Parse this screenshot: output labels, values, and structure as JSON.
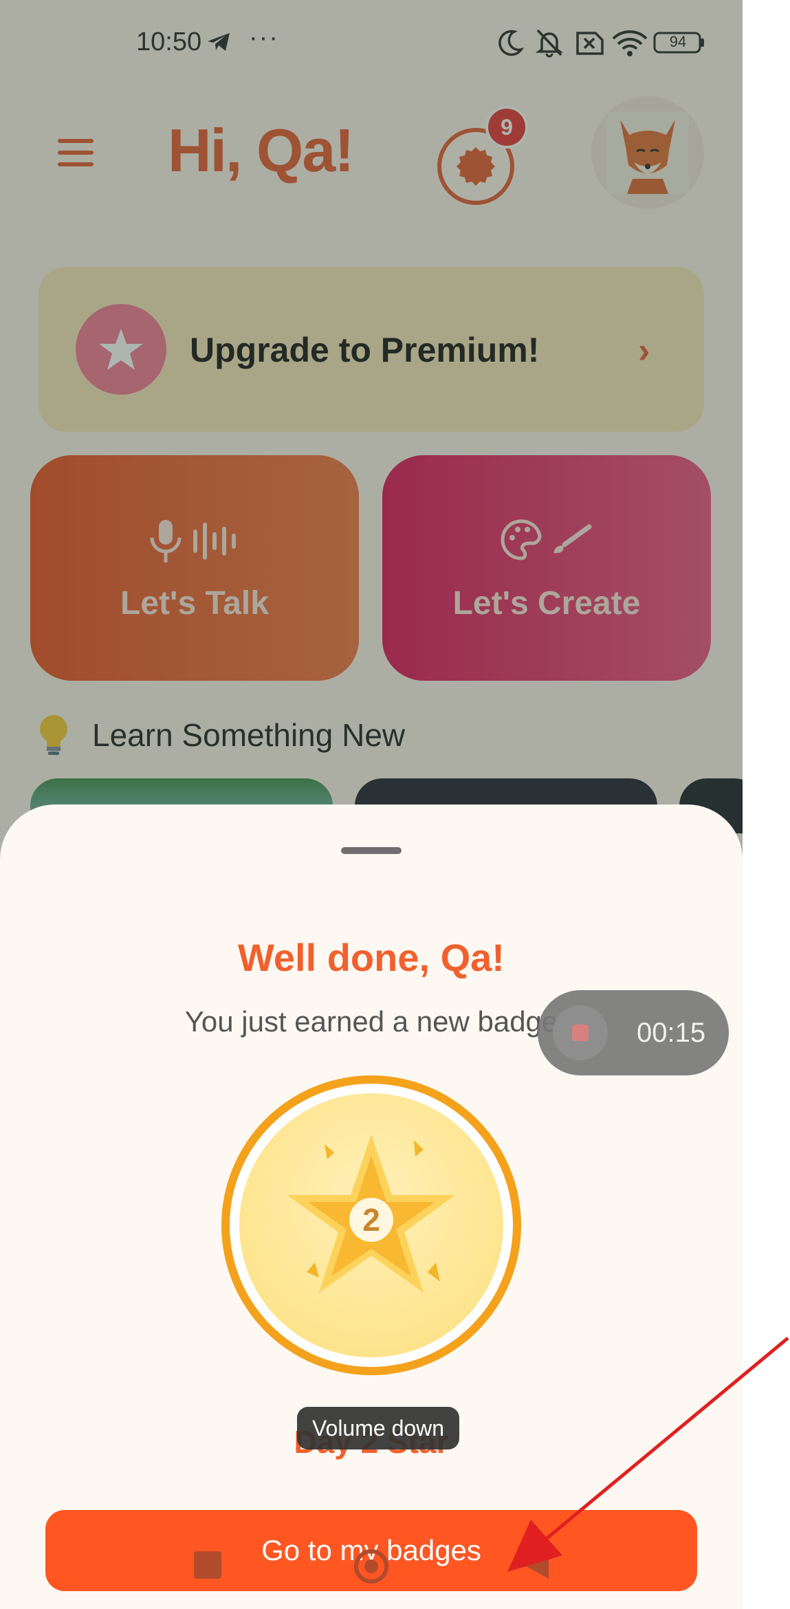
{
  "status_bar": {
    "time": "10:50",
    "more": "···",
    "battery": "94",
    "icons": [
      "telegram-icon",
      "moon-icon",
      "bell-off-icon",
      "sim-x-icon",
      "wifi-icon",
      "battery-icon"
    ]
  },
  "header": {
    "greeting": "Hi, Qa!",
    "notification_count": "9",
    "icons": [
      "menu-icon",
      "badge-seal-icon",
      "fox-avatar"
    ]
  },
  "premium": {
    "label": "Upgrade to Premium!",
    "chevron": "›",
    "icon": "star-icon"
  },
  "actions": [
    {
      "label": "Let's Talk",
      "icons": [
        "microphone-icon",
        "sound-wave-icon"
      ]
    },
    {
      "label": "Let's Create",
      "icons": [
        "palette-icon",
        "brush-icon"
      ]
    }
  ],
  "learn": {
    "title": "Learn Something New",
    "icon": "lightbulb-icon"
  },
  "sheet": {
    "title": "Well done, Qa!",
    "subtitle": "You just earned a new badge",
    "badge_number": "2",
    "badge_name": "Day 2 Star",
    "cta": "Go to my badges"
  },
  "recorder": {
    "time": "00:15"
  },
  "toast": {
    "text": "Volume down"
  },
  "colors": {
    "accent": "#f0612e",
    "primary_button": "#ff5622",
    "talk_tile": "#e84b1f",
    "create_tile": "#db1154",
    "premium_card": "#f6e6b9",
    "annotation": "#e02020"
  }
}
